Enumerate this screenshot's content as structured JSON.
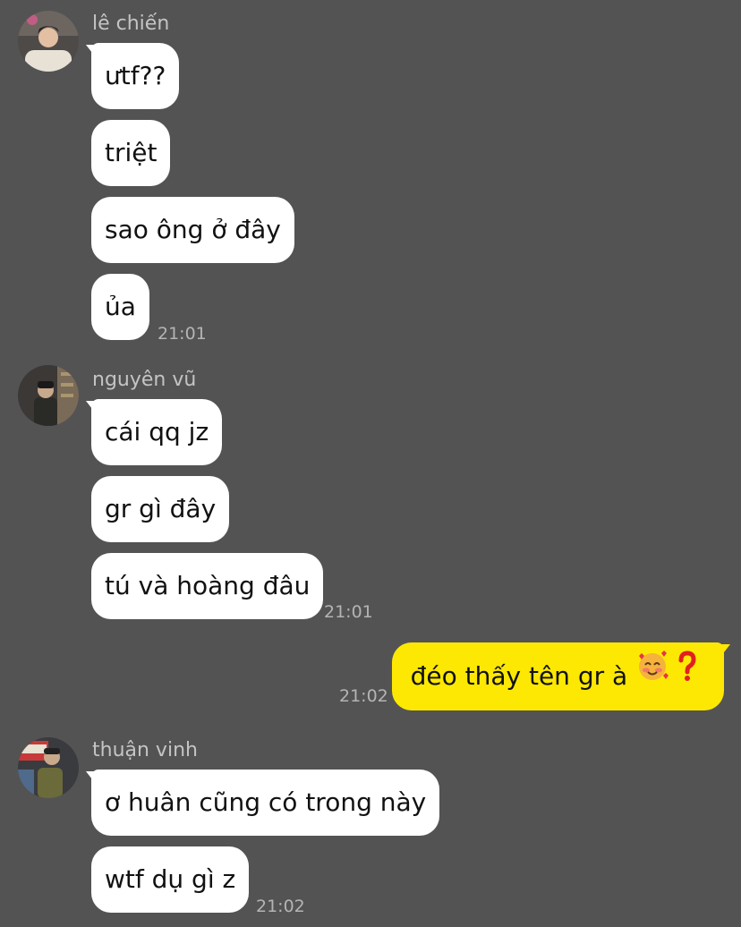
{
  "groups": [
    {
      "sender": "lê chiến",
      "avatar": "avatar-le-chien",
      "messages": [
        "ưtf??",
        "triệt",
        "sao ông ở đây",
        "ủa"
      ],
      "time": "21:01"
    },
    {
      "sender": "nguyên vũ",
      "avatar": "avatar-nguyen-vu",
      "messages": [
        "cái qq jz",
        "gr gì đây",
        "tú và hoàng đâu"
      ],
      "time": "21:01"
    },
    {
      "mine": true,
      "messages": [
        "đéo thấy tên gr à"
      ],
      "emojis": [
        "smiling-face-with-hearts-icon",
        "red-question-mark-icon"
      ],
      "time": "21:02"
    },
    {
      "sender": "thuận vinh",
      "avatar": "avatar-thuan-vinh",
      "messages": [
        "ơ huân cũng có trong này",
        "wtf dụ gì z"
      ],
      "time": "21:02"
    }
  ],
  "colors": {
    "background": "#545354",
    "incoming_bubble": "#ffffff",
    "outgoing_bubble": "#fde803",
    "meta_text": "#c4c4c4"
  }
}
